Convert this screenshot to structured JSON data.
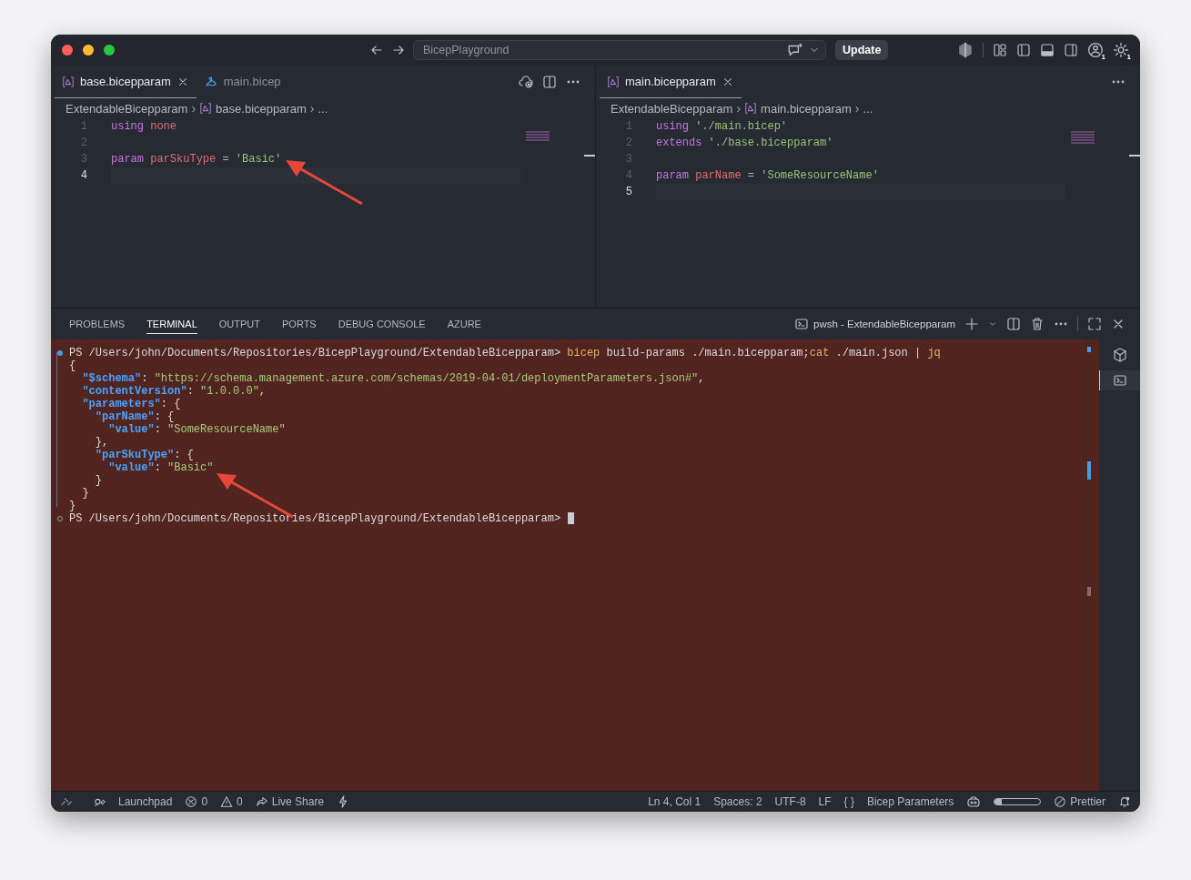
{
  "window": {
    "search": "BicepPlayground",
    "update_button": "Update",
    "account_badge": "1",
    "settings_badge": "1"
  },
  "editor_groups": [
    {
      "tabs": [
        {
          "label": "base.bicepparam",
          "kind": "params",
          "selected": true,
          "closable": true
        },
        {
          "label": "main.bicep",
          "kind": "template",
          "selected": false,
          "closable": false
        }
      ],
      "breadcrumb": {
        "separator": "›",
        "folder": "ExtendableBicepparam",
        "file": "base.bicepparam",
        "more": "..."
      },
      "lines": [
        {
          "number": "1",
          "current": false,
          "tokens": [
            {
              "text": "using ",
              "kind": "keyword"
            },
            {
              "text": "none",
              "kind": "variable"
            }
          ]
        },
        {
          "number": "2",
          "current": false
        },
        {
          "number": "3",
          "current": false,
          "tokens": [
            {
              "text": "param ",
              "kind": "keyword"
            },
            {
              "text": "parSkuType",
              "kind": "variable"
            },
            {
              "text": " = ",
              "kind": "plain"
            },
            {
              "text": "'Basic'",
              "kind": "string"
            }
          ]
        },
        {
          "number": "4",
          "current": true
        }
      ]
    },
    {
      "tabs": [
        {
          "label": "main.bicepparam",
          "kind": "params",
          "selected": true,
          "closable": true
        }
      ],
      "breadcrumb": {
        "separator": "›",
        "folder": "ExtendableBicepparam",
        "file": "main.bicepparam",
        "more": "..."
      },
      "lines": [
        {
          "number": "1",
          "current": false,
          "tokens": [
            {
              "text": "using ",
              "kind": "keyword"
            },
            {
              "text": "'./main.bicep'",
              "kind": "string"
            }
          ]
        },
        {
          "number": "2",
          "current": false,
          "tokens": [
            {
              "text": "extends ",
              "kind": "keyword"
            },
            {
              "text": "'./base.bicepparam'",
              "kind": "string"
            }
          ]
        },
        {
          "number": "3",
          "current": false
        },
        {
          "number": "4",
          "current": false,
          "tokens": [
            {
              "text": "param ",
              "kind": "keyword"
            },
            {
              "text": "parName",
              "kind": "variable"
            },
            {
              "text": " = ",
              "kind": "plain"
            },
            {
              "text": "'SomeResourceName'",
              "kind": "string"
            }
          ]
        },
        {
          "number": "5",
          "current": true
        }
      ]
    }
  ],
  "panel": {
    "tabs": [
      {
        "label": "PROBLEMS",
        "selected": false
      },
      {
        "label": "TERMINAL",
        "selected": true
      },
      {
        "label": "OUTPUT",
        "selected": false
      },
      {
        "label": "PORTS",
        "selected": false
      },
      {
        "label": "DEBUG CONSOLE",
        "selected": false
      },
      {
        "label": "AZURE",
        "selected": false
      }
    ],
    "terminal_name": "pwsh - ExtendableBicepparam",
    "lines": [
      {
        "kind": "command",
        "tokens": [
          {
            "text": "PS /Users/john/Documents/Repositories/BicepPlayground/ExtendableBicepparam> ",
            "kind": "prompt"
          },
          {
            "text": "bicep",
            "kind": "command"
          },
          {
            "text": " build-params ./main.bicepparam;",
            "kind": "prompt"
          },
          {
            "text": "cat",
            "kind": "command"
          },
          {
            "text": " ./main.json | ",
            "kind": "prompt"
          },
          {
            "text": "jq",
            "kind": "command"
          }
        ]
      },
      {
        "kind": "output",
        "tokens": [
          {
            "text": "{",
            "kind": "prompt"
          }
        ]
      },
      {
        "kind": "output",
        "tokens": [
          {
            "text": "  \"$schema\"",
            "kind": "key"
          },
          {
            "text": ": ",
            "kind": "prompt"
          },
          {
            "text": "\"https://schema.management.azure.com/schemas/2019-04-01/deploymentParameters.json#\"",
            "kind": "string"
          },
          {
            "text": ",",
            "kind": "prompt"
          }
        ]
      },
      {
        "kind": "output",
        "tokens": [
          {
            "text": "  \"contentVersion\"",
            "kind": "key"
          },
          {
            "text": ": ",
            "kind": "prompt"
          },
          {
            "text": "\"1.0.0.0\"",
            "kind": "string"
          },
          {
            "text": ",",
            "kind": "prompt"
          }
        ]
      },
      {
        "kind": "output",
        "tokens": [
          {
            "text": "  \"parameters\"",
            "kind": "key"
          },
          {
            "text": ": {",
            "kind": "prompt"
          }
        ]
      },
      {
        "kind": "output",
        "tokens": [
          {
            "text": "    \"parName\"",
            "kind": "key"
          },
          {
            "text": ": {",
            "kind": "prompt"
          }
        ]
      },
      {
        "kind": "output",
        "tokens": [
          {
            "text": "      \"value\"",
            "kind": "key"
          },
          {
            "text": ": ",
            "kind": "prompt"
          },
          {
            "text": "\"SomeResourceName\"",
            "kind": "string"
          }
        ]
      },
      {
        "kind": "output",
        "tokens": [
          {
            "text": "    },",
            "kind": "prompt"
          }
        ]
      },
      {
        "kind": "output",
        "tokens": [
          {
            "text": "    \"parSkuType\"",
            "kind": "key"
          },
          {
            "text": ": {",
            "kind": "prompt"
          }
        ]
      },
      {
        "kind": "output",
        "tokens": [
          {
            "text": "      \"value\"",
            "kind": "key"
          },
          {
            "text": ": ",
            "kind": "prompt"
          },
          {
            "text": "\"Basic\"",
            "kind": "string"
          }
        ]
      },
      {
        "kind": "output",
        "tokens": [
          {
            "text": "    }",
            "kind": "prompt"
          }
        ]
      },
      {
        "kind": "output",
        "tokens": [
          {
            "text": "  }",
            "kind": "prompt"
          }
        ]
      },
      {
        "kind": "output",
        "tokens": [
          {
            "text": "}",
            "kind": "prompt"
          }
        ]
      },
      {
        "kind": "prompt",
        "cursor": true,
        "tokens": [
          {
            "text": "PS /Users/john/Documents/Repositories/BicepPlayground/ExtendableBicepparam> ",
            "kind": "prompt"
          }
        ]
      }
    ]
  },
  "status_bar": {
    "left": [
      {
        "kind": "remote"
      },
      {
        "kind": "launchpad",
        "label": "Launchpad"
      },
      {
        "kind": "error",
        "label": "0"
      },
      {
        "kind": "warning",
        "label": "0"
      },
      {
        "kind": "share",
        "label": "Live Share"
      },
      {
        "kind": "bolt"
      }
    ],
    "right": [
      {
        "kind": "text",
        "label": "Ln 4, Col 1"
      },
      {
        "kind": "text",
        "label": "Spaces: 2"
      },
      {
        "kind": "text",
        "label": "UTF-8"
      },
      {
        "kind": "text",
        "label": "LF"
      },
      {
        "kind": "text",
        "label": "{ }"
      },
      {
        "kind": "text",
        "label": "Bicep Parameters"
      },
      {
        "kind": "copilot"
      },
      {
        "kind": "meter",
        "level": 0.15
      },
      {
        "kind": "prettier",
        "label": "Prettier"
      },
      {
        "kind": "bell"
      }
    ]
  }
}
